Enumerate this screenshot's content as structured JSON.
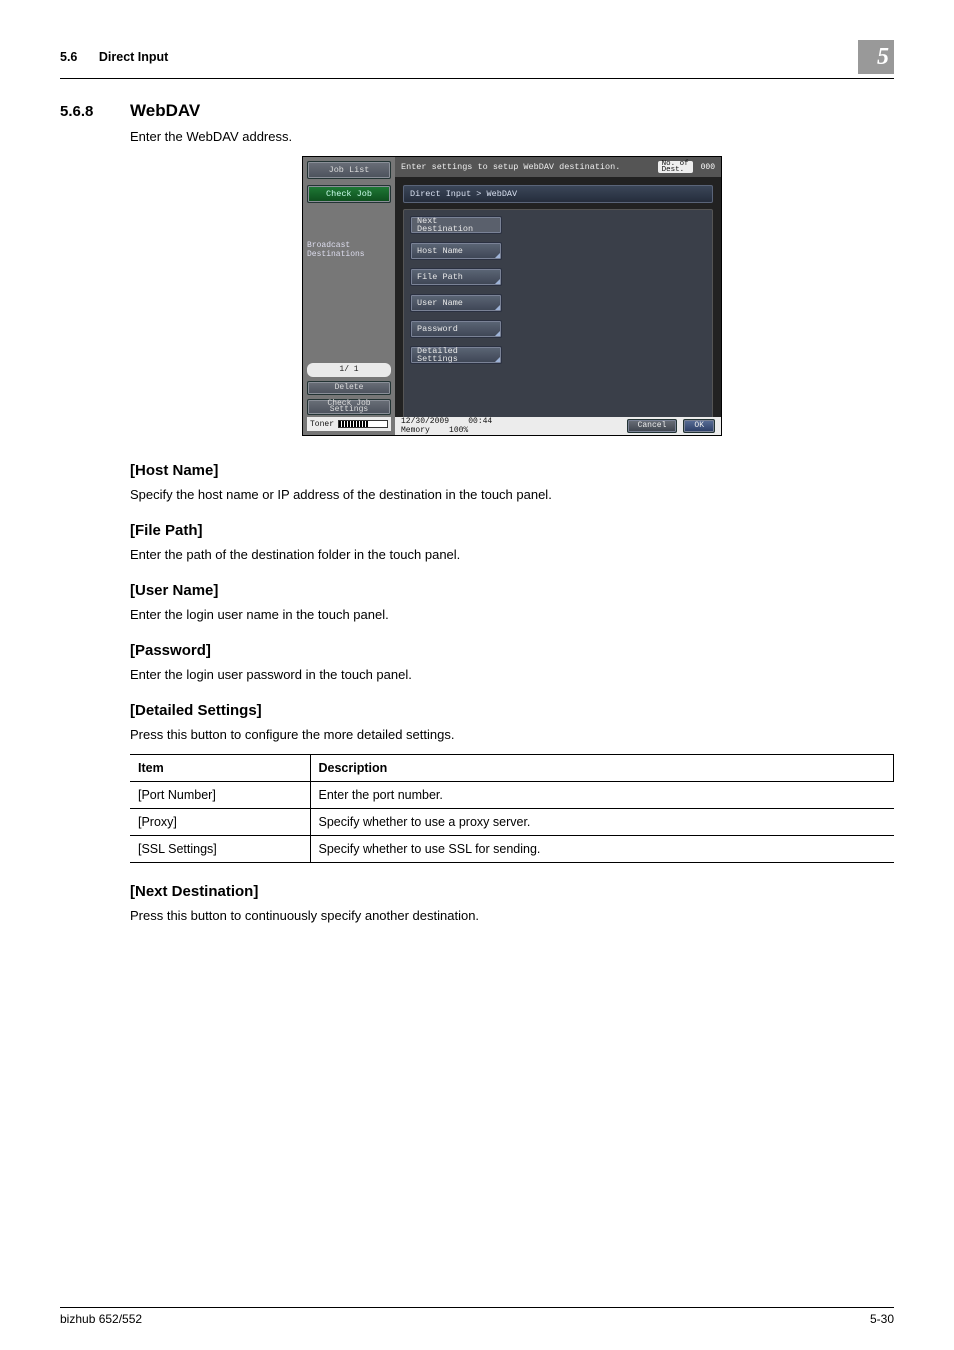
{
  "header": {
    "section_number": "5.6",
    "section_title": "Direct Input",
    "chapter_number": "5"
  },
  "section": {
    "number": "5.6.8",
    "title": "WebDAV",
    "intro": "Enter the WebDAV address."
  },
  "panel": {
    "left": {
      "job_list": "Job List",
      "check_job": "Check Job",
      "broadcast": "Broadcast\nDestinations",
      "page": "1/   1",
      "delete": "Delete",
      "check_settings": "Check Job\nSettings",
      "toner_label": "Toner"
    },
    "top": {
      "instruction": "Enter settings to setup WebDAV destination.",
      "dest_label": "No. of\nDest.",
      "dest_count": "000"
    },
    "breadcrumb": "Direct Input > WebDAV",
    "fields": {
      "next_dest": "Next\nDestination",
      "host_name": "Host Name",
      "file_path": "File Path",
      "user_name": "User Name",
      "password": "Password",
      "detailed": "Detailed\nSettings"
    },
    "bottom": {
      "date": "12/30/2009",
      "time": "00:44",
      "memory_label": "Memory",
      "memory_value": "100%",
      "cancel": "Cancel",
      "ok": "OK"
    }
  },
  "subsections": [
    {
      "title": "[Host Name]",
      "text": "Specify the host name or IP address of the destination in the touch panel."
    },
    {
      "title": "[File Path]",
      "text": "Enter the path of the destination folder in the touch panel."
    },
    {
      "title": "[User Name]",
      "text": "Enter the login user name in the touch panel."
    },
    {
      "title": "[Password]",
      "text": "Enter the login user password in the touch panel."
    },
    {
      "title": "[Detailed Settings]",
      "text": "Press this button to configure the more detailed settings."
    }
  ],
  "table": {
    "headers": {
      "item": "Item",
      "desc": "Description"
    },
    "rows": [
      {
        "item": "[Port Number]",
        "desc": "Enter the port number."
      },
      {
        "item": "[Proxy]",
        "desc": "Specify whether to use a proxy server."
      },
      {
        "item": "[SSL Settings]",
        "desc": "Specify whether to use SSL for sending."
      }
    ]
  },
  "next_dest_section": {
    "title": "[Next Destination]",
    "text": "Press this button to continuously specify another destination."
  },
  "footer": {
    "left": "bizhub 652/552",
    "right": "5-30"
  }
}
